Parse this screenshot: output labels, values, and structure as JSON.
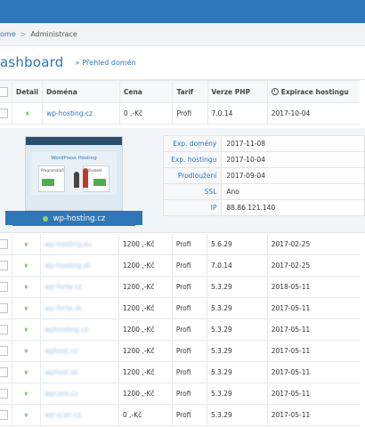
{
  "breadcrumb": {
    "home": "ome",
    "separator": ">",
    "current": "Administrace"
  },
  "page": {
    "title": "ashboard",
    "subtitle_arrow": "»",
    "subtitle": "Přehled domén"
  },
  "table": {
    "headers": [
      "Detail",
      "Doména",
      "Cena",
      "Tarif",
      "Verze PHP",
      "Expirace hostingu"
    ],
    "expanded_row": {
      "chevron": "»",
      "domain": "wp-hosting.cz",
      "price": "0 ,-Kč",
      "plan": "Profi",
      "php": "7.0.14",
      "expiry": "2017-10-04"
    },
    "rows": [
      {
        "chevron": "»",
        "domain": "wp-hosting.eu",
        "price": "1200 ,-Kč",
        "plan": "Profi",
        "php": "5.6.29",
        "expiry": "2017-02-25"
      },
      {
        "chevron": "»",
        "domain": "wp-hosting.sk",
        "price": "1200 ,-Kč",
        "plan": "Profi",
        "php": "7.0.14",
        "expiry": "2017-02-25"
      },
      {
        "chevron": "»",
        "domain": "wp-forte.cz",
        "price": "1200 ,-Kč",
        "plan": "Profi",
        "php": "5.3.29",
        "expiry": "2018-05-11"
      },
      {
        "chevron": "»",
        "domain": "wp-forte.sk",
        "price": "1200 ,-Kč",
        "plan": "Profi",
        "php": "5.3.29",
        "expiry": "2017-05-11"
      },
      {
        "chevron": "»",
        "domain": "wphosting.cz",
        "price": "1200 ,-Kč",
        "plan": "Profi",
        "php": "5.3.29",
        "expiry": "2017-05-11"
      },
      {
        "chevron": "»",
        "domain": "wphost.cz",
        "price": "1200 ,-Kč",
        "plan": "Profi",
        "php": "5.3.29",
        "expiry": "2017-05-11"
      },
      {
        "chevron": "»",
        "domain": "wphost.sk",
        "price": "1200 ,-Kč",
        "plan": "Profi",
        "php": "5.3.29",
        "expiry": "2017-05-11"
      },
      {
        "chevron": "»",
        "domain": "wpcore.cz",
        "price": "1200 ,-Kč",
        "plan": "Profi",
        "php": "5.3.29",
        "expiry": "2017-05-11"
      },
      {
        "chevron": "»",
        "domain": "wp-scan.cz",
        "price": "0 ,-Kč",
        "plan": "Profi",
        "php": "5.3.29",
        "expiry": "2017-05-11"
      }
    ]
  },
  "detail": {
    "screenshot": {
      "title": "WordPress Hosting",
      "left_label": "Programátoři",
      "right_label": "Uživatelé"
    },
    "ribbon_label": "wp-hosting.cz",
    "info": [
      {
        "key": "Exp. domény",
        "value": "2017-11-08"
      },
      {
        "key": "Exp. hostingu",
        "value": "2017-10-04"
      },
      {
        "key": "Prodloužení",
        "value": "2017-09-04"
      },
      {
        "key": "SSL",
        "value": "Ano"
      },
      {
        "key": "IP",
        "value": "88.86.121.140"
      }
    ]
  },
  "colors": {
    "accent": "#2e76b8",
    "chevron": "#3fae29"
  }
}
